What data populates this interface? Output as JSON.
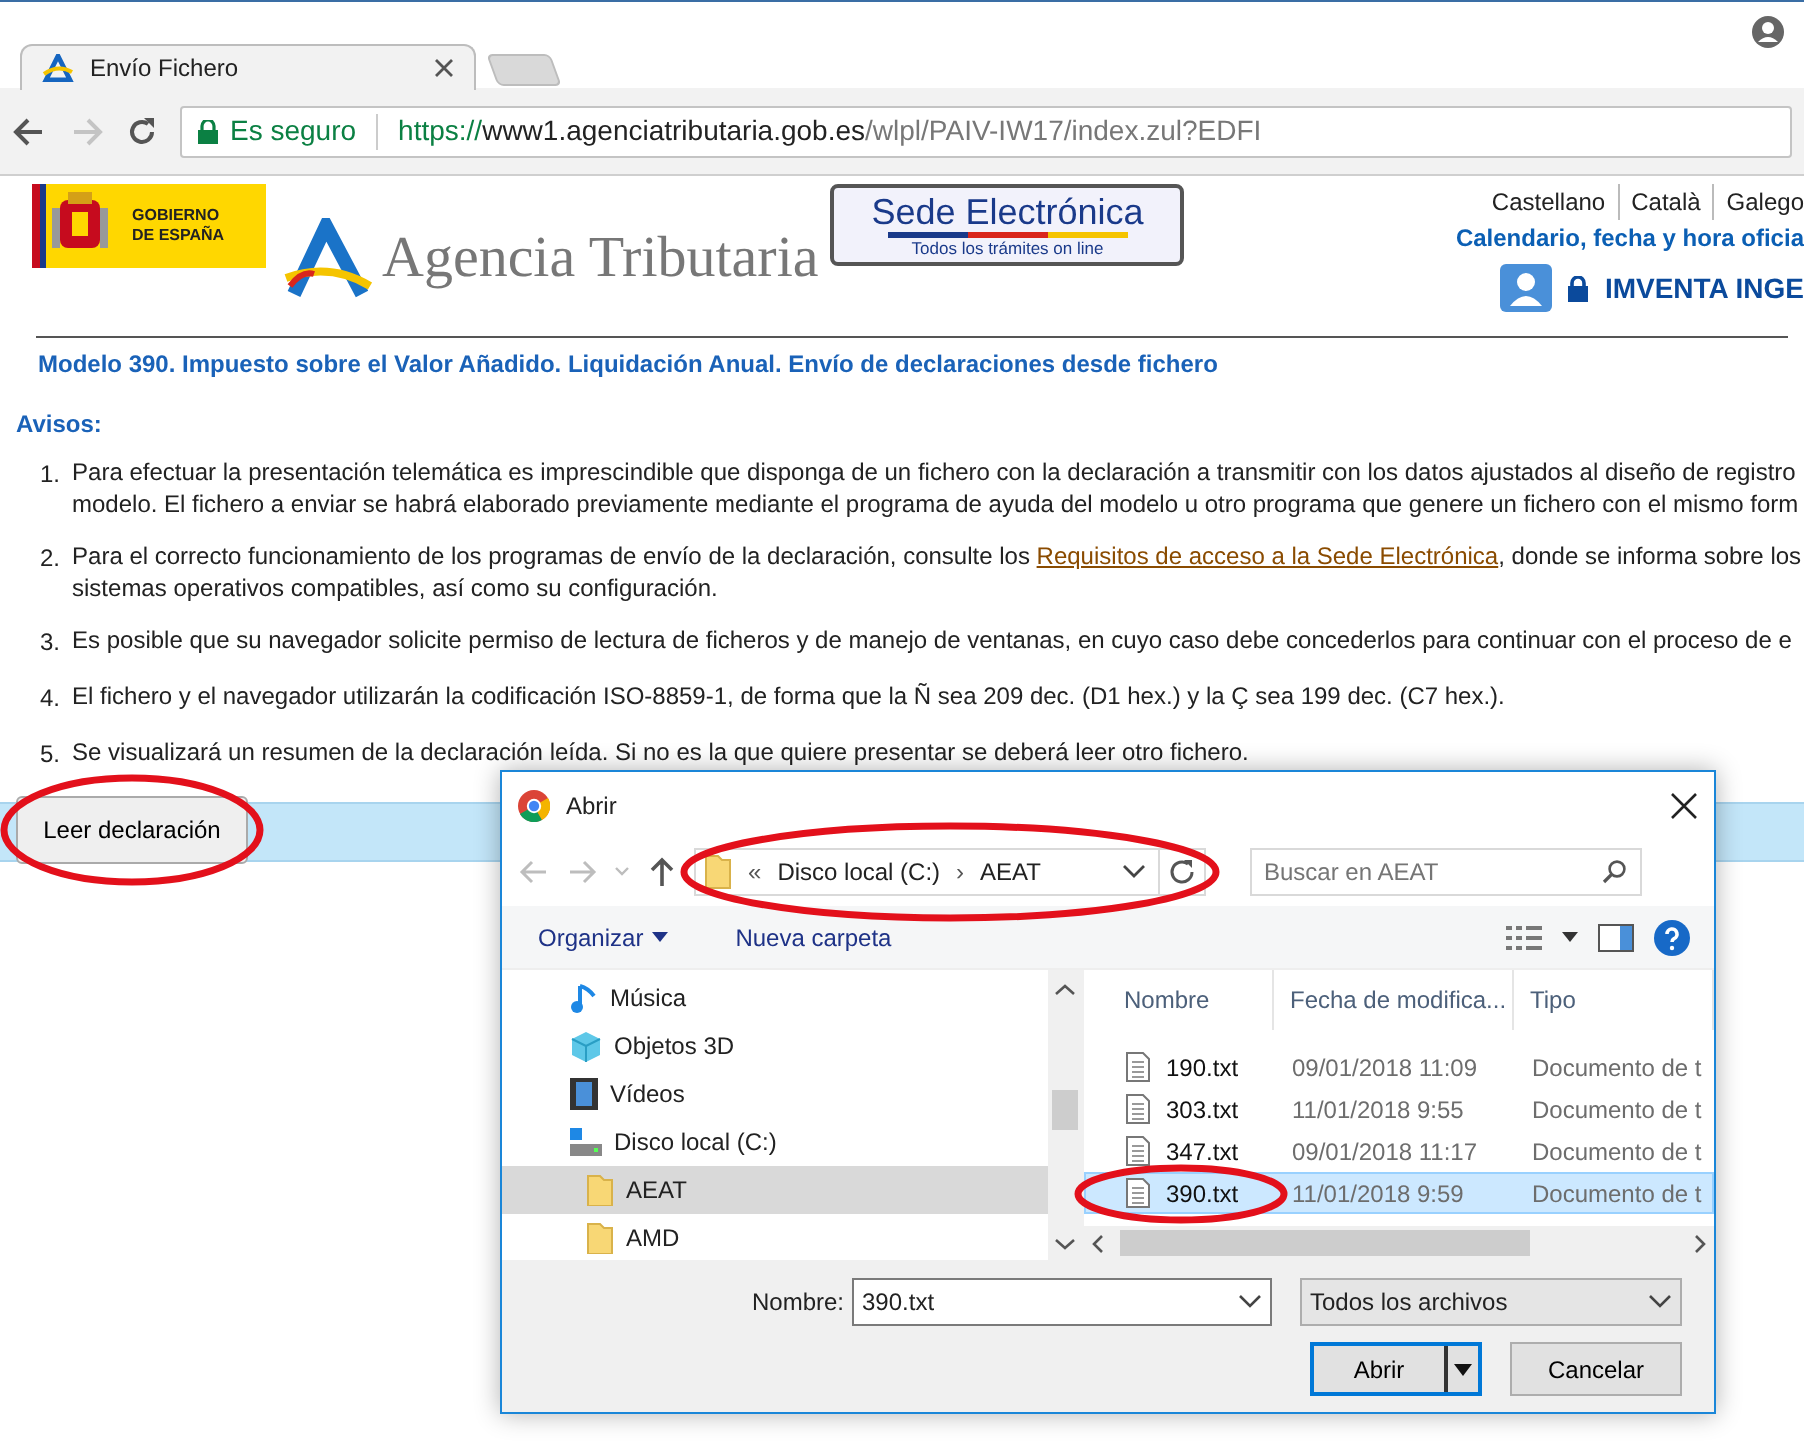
{
  "browser": {
    "tab": {
      "title": "Envío Fichero"
    },
    "nav": [
      {
        "kind": "back",
        "disabled": false
      },
      {
        "kind": "forward",
        "disabled": true
      },
      {
        "kind": "reload",
        "disabled": false
      }
    ],
    "security": "Es seguro",
    "url": {
      "scheme": "https://",
      "host": "www1.agenciatributaria.gob.es",
      "path": "/wlpl/PAIV-IW17/index.zul?EDFI"
    }
  },
  "header": {
    "gov_logo": [
      "GOBIERNO",
      "DE ESPAÑA"
    ],
    "agency": "Agencia Tributaria",
    "sede": {
      "title": "Sede Electrónica",
      "subtitle": "Todos los trámites on line"
    },
    "languages": [
      "Castellano",
      "Català",
      "Galego"
    ],
    "calendar_link": "Calendario, fecha y hora oficia",
    "user": "IMVENTA INGE"
  },
  "page": {
    "title": "Modelo 390. Impuesto sobre el Valor Añadido. Liquidación Anual. Envío de declaraciones desde fichero",
    "notices_heading": "Avisos:",
    "notices": [
      {
        "number": "1.",
        "lines": [
          [
            {
              "text": "Para efectuar la presentación telemática es imprescindible que disponga de un fichero con la declaración a transmitir con los datos ajustados al diseño de registro",
              "link": false
            }
          ],
          [
            {
              "text": "modelo. El fichero a enviar se habrá elaborado previamente mediante el programa de ayuda del modelo u otro programa que genere un fichero con el mismo form",
              "link": false
            }
          ]
        ]
      },
      {
        "number": "2.",
        "lines": [
          [
            {
              "text": "Para el correcto funcionamiento de los programas de envío de la declaración, consulte los ",
              "link": false
            },
            {
              "text": "Requisitos de acceso a la Sede Electrónica",
              "link": true
            },
            {
              "text": ", donde se informa sobre los",
              "link": false
            }
          ],
          [
            {
              "text": "sistemas operativos compatibles, así como su configuración.",
              "link": false
            }
          ]
        ]
      },
      {
        "number": "3.",
        "lines": [
          [
            {
              "text": "Es posible que su navegador solicite permiso de lectura de ficheros y de manejo de ventanas, en cuyo caso debe concederlos para continuar con el proceso de e",
              "link": false
            }
          ]
        ]
      },
      {
        "number": "4.",
        "lines": [
          [
            {
              "text": "El fichero y el navegador utilizarán la codificación ISO-8859-1, de forma que la Ñ sea 209 dec. (D1 hex.) y la Ç sea 199 dec. (C7 hex.).",
              "link": false
            }
          ]
        ]
      },
      {
        "number": "5.",
        "lines": [
          [
            {
              "text": "Se visualizará un resumen de la declaración leída. Si no es la que quiere presentar se deberá leer otro fichero.",
              "link": false
            }
          ]
        ]
      }
    ]
  },
  "read_button": {
    "label": "Leer declaración",
    "highlighted": true
  },
  "dialog": {
    "title": "Abrir",
    "nav": [
      {
        "kind": "back",
        "disabled": true
      },
      {
        "kind": "forward",
        "disabled": true
      },
      {
        "kind": "recent",
        "disabled": true
      },
      {
        "kind": "up",
        "disabled": false
      }
    ],
    "path": {
      "prefix": "«",
      "segments": [
        "Disco local (C:)",
        "AEAT"
      ],
      "separator": "›",
      "highlighted": true
    },
    "search": {
      "placeholder": "Buscar en AEAT"
    },
    "toolbar": {
      "organize": "Organizar",
      "new_folder": "Nueva carpeta"
    },
    "tree": [
      {
        "label": "Música",
        "kind": "music",
        "selected": false
      },
      {
        "label": "Objetos 3D",
        "kind": "objects",
        "selected": false
      },
      {
        "label": "Vídeos",
        "kind": "videos",
        "selected": false
      },
      {
        "label": "Disco local (C:)",
        "kind": "drive",
        "selected": false,
        "children": [
          {
            "label": "AEAT",
            "kind": "folder",
            "selected": true
          },
          {
            "label": "AMD",
            "kind": "folder",
            "selected": false
          }
        ]
      }
    ],
    "columns": [
      "Nombre",
      "Fecha de modifica...",
      "Tipo"
    ],
    "files": [
      {
        "name": "190.txt",
        "modified": "09/01/2018 11:09",
        "type": "Documento de t",
        "selected": false,
        "highlighted": false
      },
      {
        "name": "303.txt",
        "modified": "11/01/2018 9:55",
        "type": "Documento de t",
        "selected": false,
        "highlighted": false
      },
      {
        "name": "347.txt",
        "modified": "09/01/2018 11:17",
        "type": "Documento de t",
        "selected": false,
        "highlighted": false
      },
      {
        "name": "390.txt",
        "modified": "11/01/2018 9:59",
        "type": "Documento de t",
        "selected": true,
        "highlighted": true
      }
    ],
    "filename_label": "Nombre:",
    "filename": "390.txt",
    "filter": "Todos los archivos",
    "buttons": [
      {
        "label": "Abrir",
        "kind": "primary"
      },
      {
        "label": "Cancelar",
        "kind": "cancel"
      }
    ]
  }
}
